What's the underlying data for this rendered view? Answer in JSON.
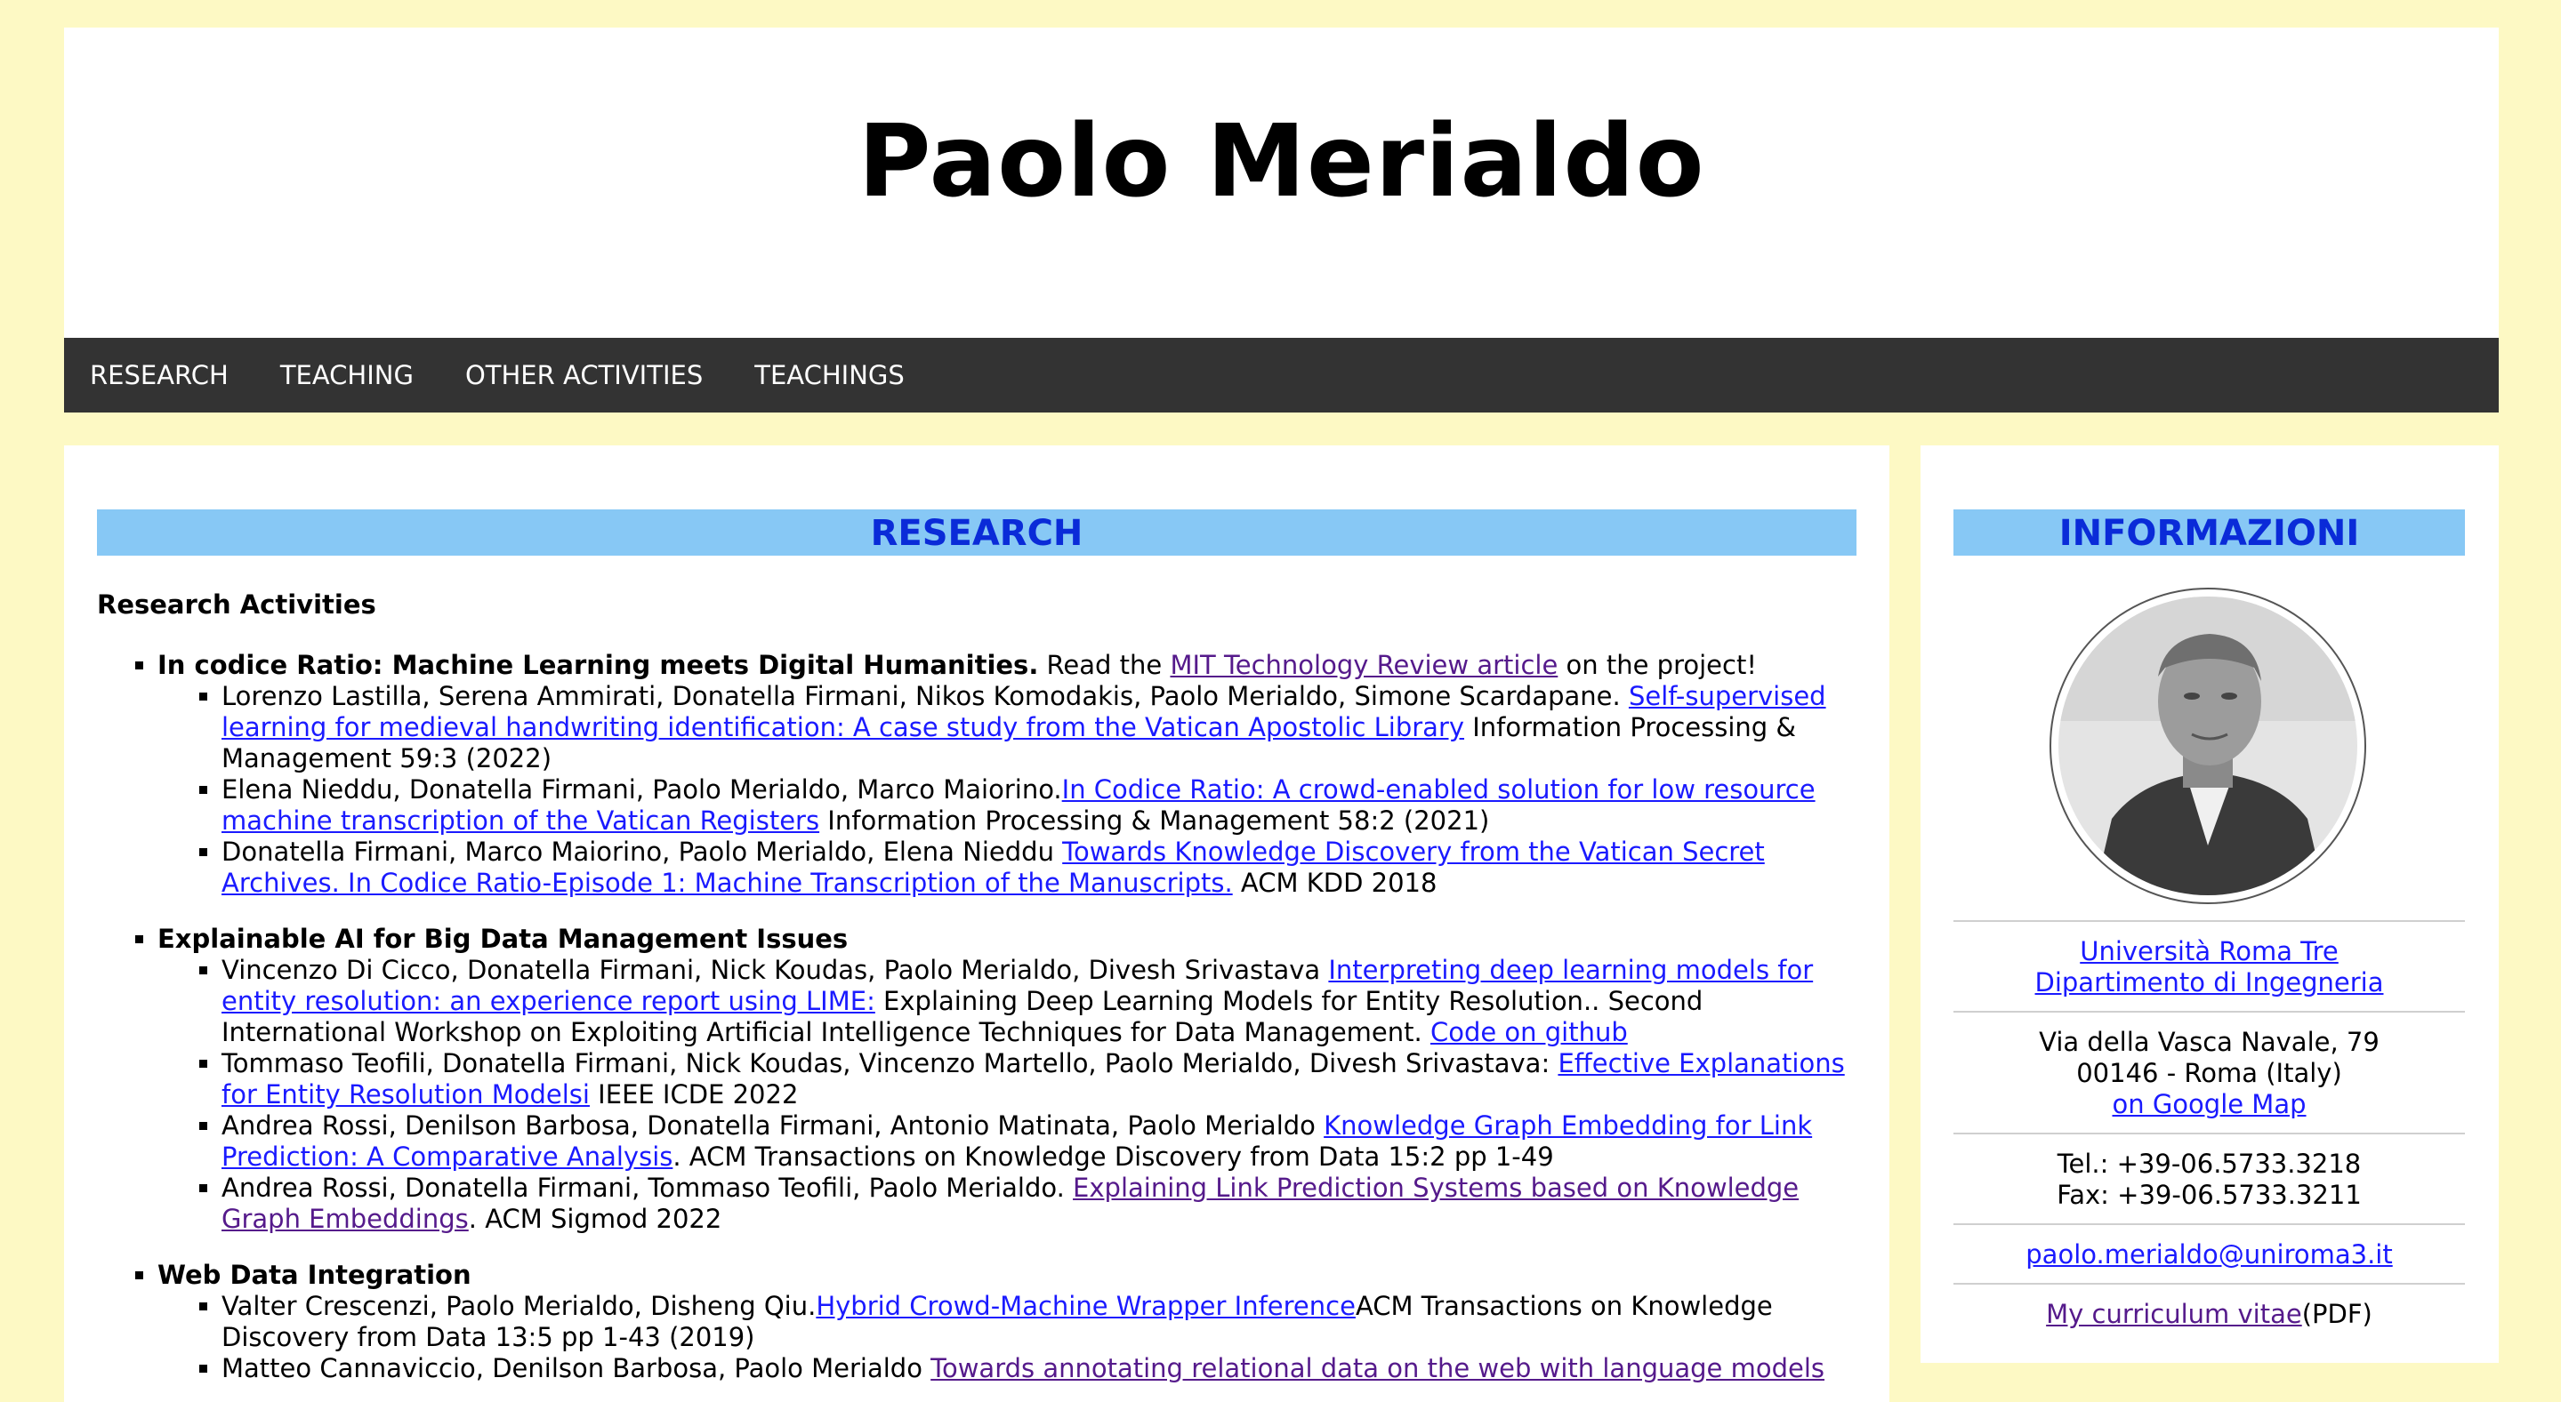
{
  "header": {
    "title": "Paolo Merialdo"
  },
  "nav": {
    "items": [
      "RESEARCH",
      "TEACHING",
      "OTHER ACTIVITIES",
      "TEACHINGS"
    ]
  },
  "main": {
    "section_title": "RESEARCH",
    "subtitle": "Research Activities",
    "topics": [
      {
        "title": "In codice Ratio: Machine Learning meets Digital Humanities.",
        "text_before": " Read the ",
        "link": "MIT Technology Review article",
        "text_after": " on the project!",
        "pubs": [
          {
            "authors": "Lorenzo Lastilla, Serena Ammirati, Donatella Firmani, Nikos Komodakis, Paolo Merialdo, Simone Scardapane. ",
            "link": "Self-supervised learning for medieval handwriting identification: A case study from the Vatican Apostolic Library",
            "venue": " Information Processing & Management 59:3 (2022)"
          },
          {
            "authors": "Elena Nieddu, Donatella Firmani, Paolo Merialdo, Marco Maiorino.",
            "link": "In Codice Ratio: A crowd-enabled solution for low resource machine transcription of the Vatican Registers",
            "venue": " Information Processing & Management 58:2 (2021)"
          },
          {
            "authors": "Donatella Firmani, Marco Maiorino, Paolo Merialdo, Elena Nieddu ",
            "link": "Towards Knowledge Discovery from the Vatican Secret Archives. In Codice Ratio-Episode 1: Machine Transcription of the Manuscripts.",
            "venue": " ACM KDD 2018"
          }
        ]
      },
      {
        "title": "Explainable AI for Big Data Management Issues",
        "pubs": [
          {
            "authors": "Vincenzo Di Cicco, Donatella Firmani, Nick Koudas, Paolo Merialdo, Divesh Srivastava ",
            "link": "Interpreting deep learning models for entity resolution: an experience report using LIME:",
            "venue": " Explaining Deep Learning Models for Entity Resolution.. Second International Workshop on Exploiting Artificial Intelligence Techniques for Data Management. ",
            "link2": "Code on github"
          },
          {
            "authors": "Tommaso Teofili, Donatella Firmani, Nick Koudas, Vincenzo Martello, Paolo Merialdo, Divesh Srivastava: ",
            "link": "Effective Explanations for Entity Resolution Modelsi",
            "venue": " IEEE ICDE 2022"
          },
          {
            "authors": "Andrea Rossi, Denilson Barbosa, Donatella Firmani, Antonio Matinata, Paolo Merialdo ",
            "link": "Knowledge Graph Embedding for Link Prediction: A Comparative Analysis",
            "venue": ". ACM Transactions on Knowledge Discovery from Data 15:2 pp 1-49"
          },
          {
            "authors": "Andrea Rossi, Donatella Firmani, Tommaso Teofili, Paolo Merialdo. ",
            "link": "Explaining Link Prediction Systems based on Knowledge Graph Embeddings",
            "venue": ". ACM Sigmod 2022"
          }
        ]
      },
      {
        "title": "Web Data Integration",
        "pubs": [
          {
            "authors": "Valter Crescenzi, Paolo Merialdo, Disheng Qiu.",
            "link": "Hybrid Crowd-Machine Wrapper Inference",
            "venue": "ACM Transactions on Knowledge Discovery from Data 13:5 pp 1-43 (2019)"
          },
          {
            "authors": "Matteo Cannaviccio, Denilson Barbosa, Paolo Merialdo ",
            "link": "Towards annotating relational data on the web with language models",
            "venue": ""
          }
        ]
      }
    ]
  },
  "sidebar": {
    "title": "INFORMAZIONI",
    "avatar_icon": "profile-photo",
    "university_link": "Università Roma Tre",
    "department_link": "Dipartimento di Ingegneria",
    "address_line1": "Via della Vasca Navale, 79",
    "address_line2": "00146 - Roma (Italy)",
    "map_link": "on Google Map",
    "tel": "Tel.: +39-06.5733.3218",
    "fax": "Fax: +39-06.5733.3211",
    "email": "paolo.merialdo@uniroma3.it",
    "cv_link": "My curriculum vitae",
    "cv_suffix": "(PDF)"
  },
  "colors": {
    "page_bg": "#fdf9c4",
    "navbar_bg": "#333333",
    "section_title_bg": "#87c8f5",
    "section_title_text": "#0a2bd8",
    "link": "#1a1aff",
    "visited_link": "#551a8b"
  }
}
